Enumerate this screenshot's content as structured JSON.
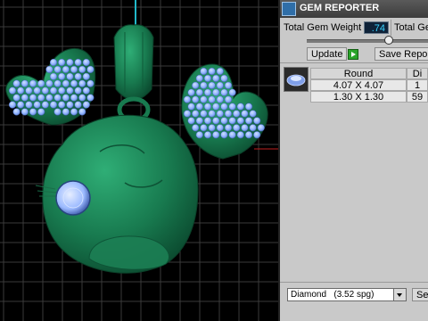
{
  "panel": {
    "title": "GEM REPORTER",
    "total_gem_weight_label": "Total Gem Weight",
    "total_gem_weight_value": ".74",
    "total_gem_label_2": "Total Ge",
    "update_label": "Update",
    "save_report_label": "Save Repor"
  },
  "table": {
    "headers": [
      "Round",
      "Di"
    ],
    "rows": [
      {
        "size": "4.07 X 4.07",
        "count": "1"
      },
      {
        "size": "1.30 X 1.30",
        "count": "59"
      }
    ]
  },
  "gem_select": {
    "value": "Diamond",
    "spg": "(3.52 spg)"
  },
  "bottom_button_label": "Se",
  "colors": {
    "viewport_bg": "#000000",
    "grid": "#3a3a3a",
    "model_green": "#1f8a5c",
    "gem_blue": "#8fb2ff",
    "panel_bg": "#c9c9c9",
    "field_text": "#39d3ff"
  }
}
